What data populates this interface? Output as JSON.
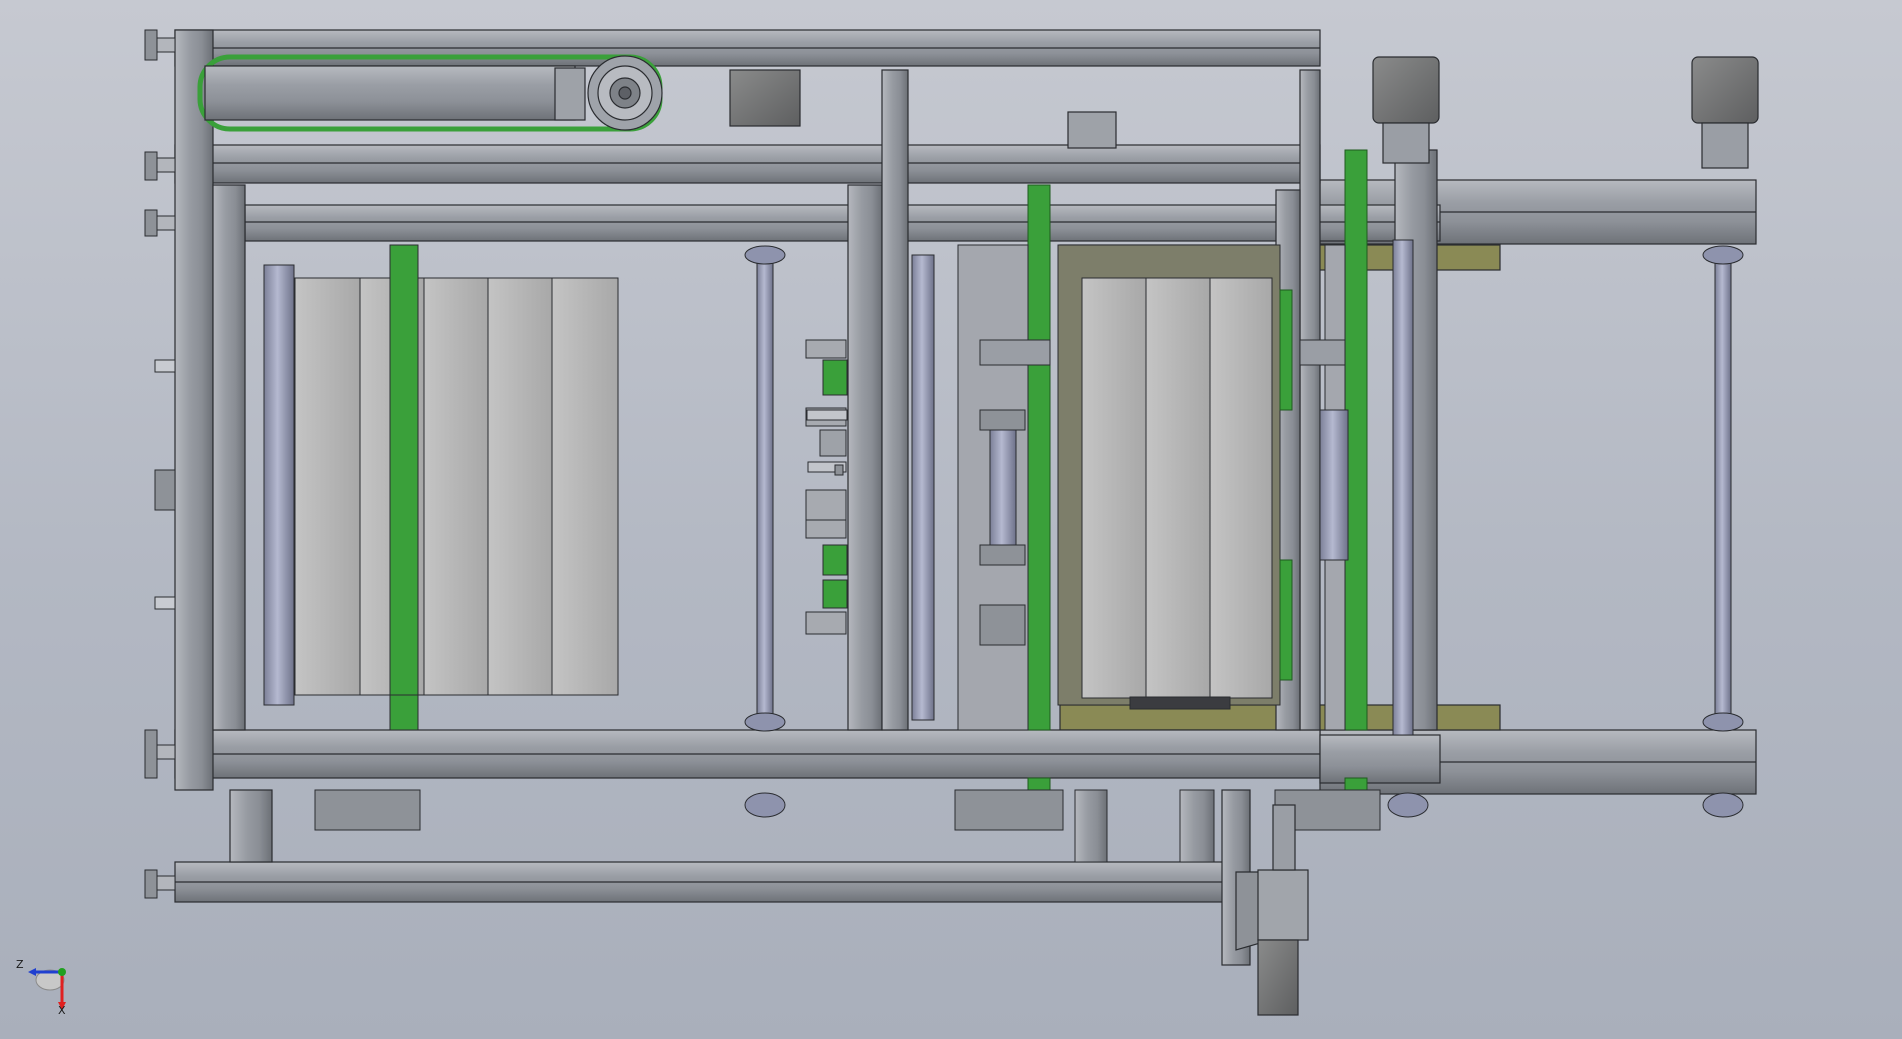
{
  "viewport": {
    "background_top": "#c6c9d1",
    "background_bottom": "#a9afbb"
  },
  "colors": {
    "profile": "#9fa3aa",
    "profile_dark": "#6e7278",
    "edge": "#2a2c30",
    "belt_green": "#3aa03a",
    "plate_light": "#b8b8b8",
    "shaft": "#8e93ad",
    "olive_plate": "#8a8a55",
    "motor_dark": "#6f7070"
  },
  "triad": {
    "x_label": "X",
    "z_label": "Z",
    "x_color": "#e02020",
    "z_color": "#2040d0",
    "y_color": "#20a020"
  }
}
